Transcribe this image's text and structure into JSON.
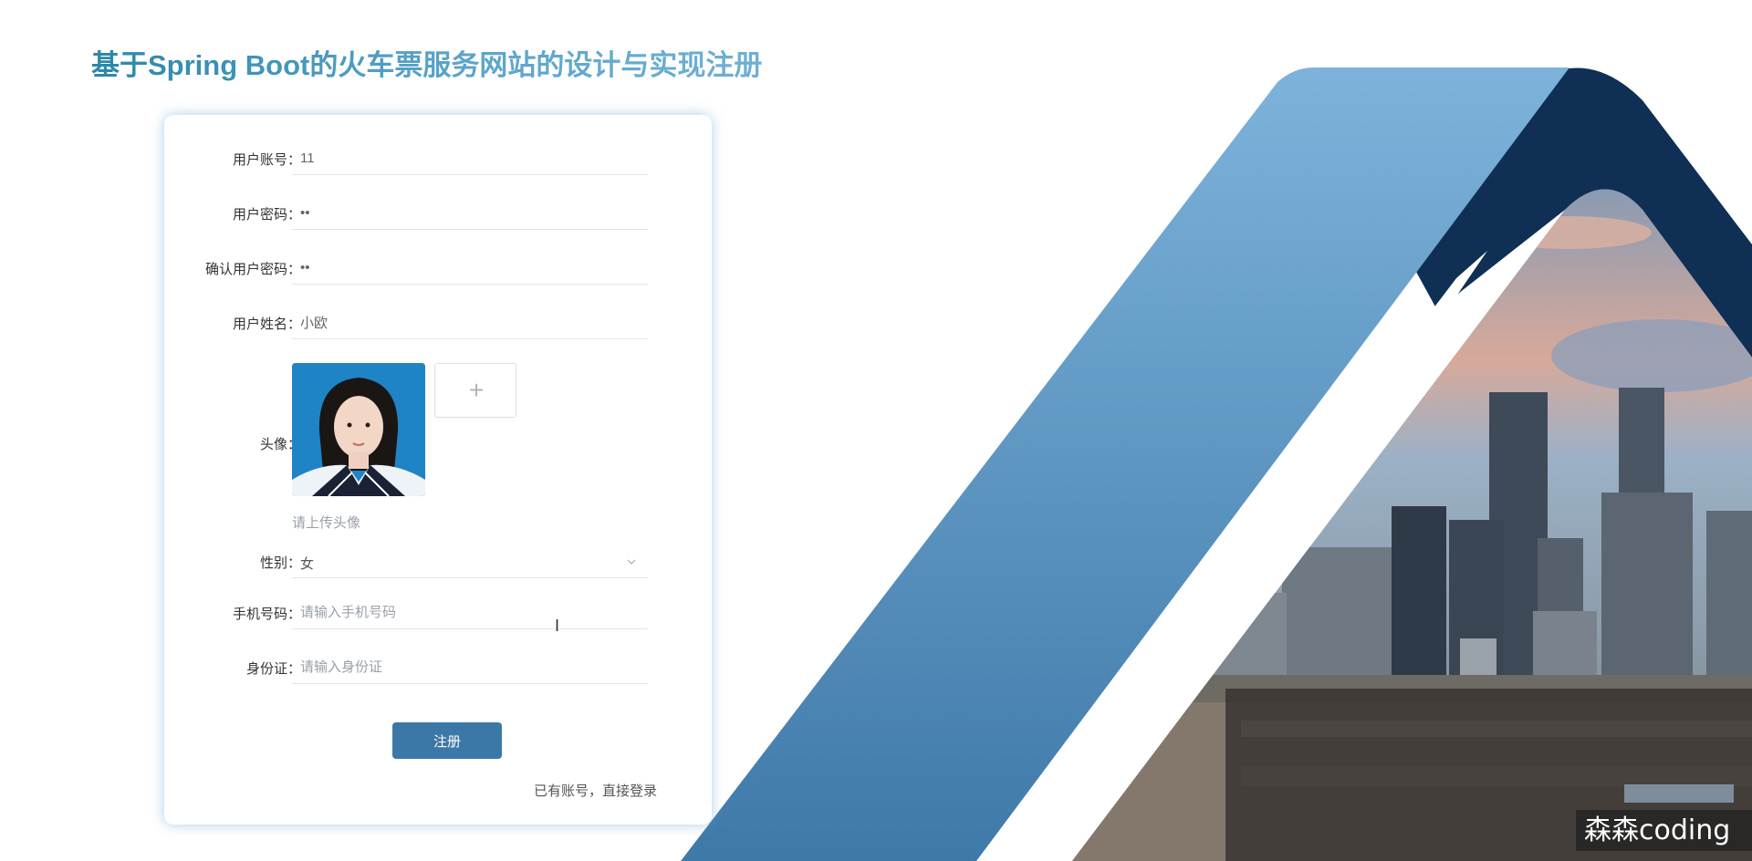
{
  "page": {
    "title": "基于Spring Boot的火车票服务网站的设计与实现注册"
  },
  "form": {
    "account": {
      "label": "用户账号：",
      "value": "11"
    },
    "password": {
      "label": "用户密码：",
      "value": "••"
    },
    "confirm_password": {
      "label": "确认用户密码：",
      "value": "••"
    },
    "real_name": {
      "label": "用户姓名：",
      "value": "小欧"
    },
    "avatar": {
      "label": "头像：",
      "upload_icon": "plus-icon",
      "tip": "请上传头像"
    },
    "gender": {
      "label": "性别：",
      "selected": "女",
      "arrow_icon": "chevron-down-icon"
    },
    "phone": {
      "label": "手机号码：",
      "value": "",
      "placeholder": "请输入手机号码"
    },
    "id_card": {
      "label": "身份证：",
      "value": "",
      "placeholder": "请输入身份证"
    },
    "submit_label": "注册",
    "login_link": "已有账号，直接登录"
  },
  "watermark": "森森coding",
  "colors": {
    "title": "#4a9ec3",
    "primary_button": "#3c78a7",
    "band_light": "#6aa6d4",
    "band_dark": "#0f2f54"
  }
}
